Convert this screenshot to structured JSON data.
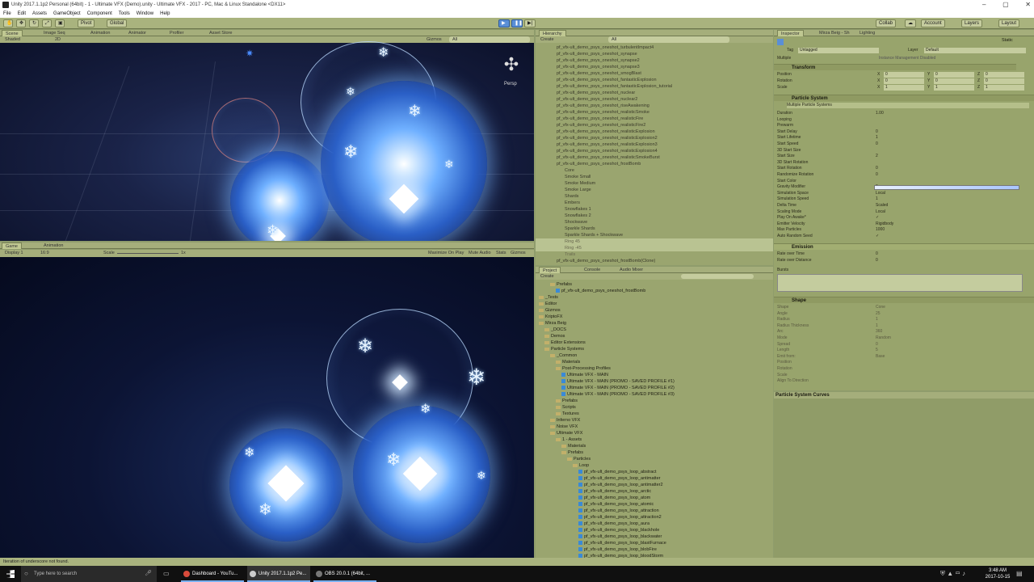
{
  "window": {
    "title": "Unity 2017.1.1p2 Personal (64bit) - 1 - Ultimate VFX (Demo).unity - Ultimate VFX - 2017 - PC, Mac & Linux Standalone <DX11>"
  },
  "menu": [
    "File",
    "Edit",
    "Assets",
    "GameObject",
    "Component",
    "Tools",
    "Window",
    "Help"
  ],
  "toolbar": {
    "pivot": "Pivot",
    "global": "Global",
    "collab": "Collab",
    "account": "Account",
    "layers": "Layers",
    "layout": "Layout"
  },
  "scene_tabs": [
    "Scene",
    "Image Seq",
    "Animation",
    "Animator",
    "Profiler",
    "Asset Store"
  ],
  "scene_bar": {
    "shaded": "Shaded",
    "mode2d": "2D",
    "gizmos": "Gizmos",
    "search": "All",
    "persp": "Persp"
  },
  "game_tabs": [
    "Game",
    "Animation"
  ],
  "game_bar": {
    "display": "Display 1",
    "aspect": "16:9",
    "scale_label": "Scale",
    "scale_value": "1x",
    "maximize": "Maximize On Play",
    "mute": "Mute Audio",
    "stats": "Stats",
    "gizmos": "Gizmos"
  },
  "hierarchy": {
    "tab": "Hierarchy",
    "create": "Create",
    "search": "All",
    "items": [
      "pf_vfx-ult_demo_psys_oneshot_turbulentImpact4",
      "pf_vfx-ult_demo_psys_oneshot_synapse",
      "pf_vfx-ult_demo_psys_oneshot_synapse2",
      "pf_vfx-ult_demo_psys_oneshot_synapse3",
      "pf_vfx-ult_demo_psys_oneshot_smogBlast",
      "pf_vfx-ult_demo_psys_oneshot_fantasticExplosion",
      "pf_vfx-ult_demo_psys_oneshot_fantasticExplosion_tutorial",
      "pf_vfx-ult_demo_psys_oneshot_nuclear",
      "pf_vfx-ult_demo_psys_oneshot_nuclear2",
      "pf_vfx-ult_demo_psys_oneshot_riseAwakening",
      "pf_vfx-ult_demo_psys_oneshot_realisticSmoke",
      "pf_vfx-ult_demo_psys_oneshot_realisticFire",
      "pf_vfx-ult_demo_psys_oneshot_realisticFire2",
      "pf_vfx-ult_demo_psys_oneshot_realisticExplosion",
      "pf_vfx-ult_demo_psys_oneshot_realisticExplosion2",
      "pf_vfx-ult_demo_psys_oneshot_realisticExplosion3",
      "pf_vfx-ult_demo_psys_oneshot_realisticExplosion4",
      "pf_vfx-ult_demo_psys_oneshot_realisticSmokeBurst",
      "pf_vfx-ult_demo_psys_oneshot_frostBomb"
    ],
    "children": [
      "Core",
      "Smoke Small",
      "Smoke Medium",
      "Smoke Large",
      "Shards",
      "Embers",
      "Snowflakes 1",
      "Snowflakes 2",
      "Shockwave",
      "Sparkle Shards",
      "Sparkle Shards + Shockwave",
      "Ring 45",
      "Ring -45",
      "Trails"
    ],
    "last": "pf_vfx-ult_demo_psys_oneshot_frostBomb(Clone)"
  },
  "project": {
    "tabs": [
      "Project",
      "Console",
      "Audio Mixer"
    ],
    "create": "Create",
    "rows": [
      {
        "d": 2,
        "t": "Prefabs",
        "k": "f"
      },
      {
        "d": 3,
        "t": "pf_vfx-ult_demo_psys_oneshot_frostBomb",
        "k": "c"
      },
      {
        "d": 0,
        "t": "_Tests",
        "k": "f"
      },
      {
        "d": 0,
        "t": "Editor",
        "k": "f"
      },
      {
        "d": 0,
        "t": "Gizmos",
        "k": "f"
      },
      {
        "d": 0,
        "t": "KriptoFX",
        "k": "f"
      },
      {
        "d": 0,
        "t": "Mirza Beig",
        "k": "f"
      },
      {
        "d": 1,
        "t": "_DOCS",
        "k": "f"
      },
      {
        "d": 1,
        "t": "Demos",
        "k": "f"
      },
      {
        "d": 1,
        "t": "Editor Extensions",
        "k": "f"
      },
      {
        "d": 1,
        "t": "Particle Systems",
        "k": "f"
      },
      {
        "d": 2,
        "t": "_Common",
        "k": "f"
      },
      {
        "d": 3,
        "t": "Materials",
        "k": "f"
      },
      {
        "d": 3,
        "t": "Post-Processing Profiles",
        "k": "f"
      },
      {
        "d": 4,
        "t": "Ultimate VFX - MAIN",
        "k": "c"
      },
      {
        "d": 4,
        "t": "Ultimate VFX - MAIN (PROMO - SAVED PROFILE #1)",
        "k": "c"
      },
      {
        "d": 4,
        "t": "Ultimate VFX - MAIN (PROMO - SAVED PROFILE #2)",
        "k": "c"
      },
      {
        "d": 4,
        "t": "Ultimate VFX - MAIN (PROMO - SAVED PROFILE #3)",
        "k": "c"
      },
      {
        "d": 3,
        "t": "Prefabs",
        "k": "f"
      },
      {
        "d": 3,
        "t": "Scripts",
        "k": "f"
      },
      {
        "d": 3,
        "t": "Textures",
        "k": "f"
      },
      {
        "d": 2,
        "t": "Inferno VFX",
        "k": "f"
      },
      {
        "d": 2,
        "t": "Noise VFX",
        "k": "f"
      },
      {
        "d": 2,
        "t": "Ultimate VFX",
        "k": "f"
      },
      {
        "d": 3,
        "t": "1 - Assets",
        "k": "f"
      },
      {
        "d": 4,
        "t": "Materials",
        "k": "f"
      },
      {
        "d": 4,
        "t": "Prefabs",
        "k": "f"
      },
      {
        "d": 5,
        "t": "Particles",
        "k": "f"
      },
      {
        "d": 6,
        "t": "Loop",
        "k": "f"
      },
      {
        "d": 7,
        "t": "pf_vfx-ult_demo_psys_loop_abstract",
        "k": "c"
      },
      {
        "d": 7,
        "t": "pf_vfx-ult_demo_psys_loop_antimatter",
        "k": "c"
      },
      {
        "d": 7,
        "t": "pf_vfx-ult_demo_psys_loop_antimatter2",
        "k": "c"
      },
      {
        "d": 7,
        "t": "pf_vfx-ult_demo_psys_loop_arctic",
        "k": "c"
      },
      {
        "d": 7,
        "t": "pf_vfx-ult_demo_psys_loop_atom",
        "k": "c"
      },
      {
        "d": 7,
        "t": "pf_vfx-ult_demo_psys_loop_atomic",
        "k": "c"
      },
      {
        "d": 7,
        "t": "pf_vfx-ult_demo_psys_loop_attraction",
        "k": "c"
      },
      {
        "d": 7,
        "t": "pf_vfx-ult_demo_psys_loop_attraction2",
        "k": "c"
      },
      {
        "d": 7,
        "t": "pf_vfx-ult_demo_psys_loop_aura",
        "k": "c"
      },
      {
        "d": 7,
        "t": "pf_vfx-ult_demo_psys_loop_blackhole",
        "k": "c"
      },
      {
        "d": 7,
        "t": "pf_vfx-ult_demo_psys_loop_blackwater",
        "k": "c"
      },
      {
        "d": 7,
        "t": "pf_vfx-ult_demo_psys_loop_blastFurnace",
        "k": "c"
      },
      {
        "d": 7,
        "t": "pf_vfx-ult_demo_psys_loop_blobFire",
        "k": "c"
      },
      {
        "d": 7,
        "t": "pf_vfx-ult_demo_psys_loop_bloodStorm",
        "k": "c"
      }
    ]
  },
  "inspector": {
    "tabs": [
      "Inspector",
      "Mirza Beig - Sh",
      "Lighting"
    ],
    "static": "Static",
    "tag_label": "Tag",
    "tag": "Untagged",
    "layer_label": "Layer",
    "layer": "Default",
    "multiple": "Multiple",
    "instance_note": "Instance Management Disabled",
    "transform": "Transform",
    "pos": "Position",
    "rot": "Rotation",
    "scale": "Scale",
    "pos_v": [
      "0",
      "0",
      "0"
    ],
    "rot_v": [
      "0",
      "0",
      "0"
    ],
    "scale_v": [
      "1",
      "1",
      "1"
    ],
    "ps_title": "Particle System",
    "ps_sub": "Multiple Particle Systems",
    "props": [
      [
        "Duration",
        "1.00"
      ],
      [
        "Looping",
        ""
      ],
      [
        "Prewarm",
        ""
      ],
      [
        "Start Delay",
        "0"
      ],
      [
        "Start Lifetime",
        "1"
      ],
      [
        "Start Speed",
        "0"
      ],
      [
        "3D Start Size",
        ""
      ],
      [
        "Start Size",
        "2"
      ],
      [
        "3D Start Rotation",
        ""
      ],
      [
        "Start Rotation",
        "0"
      ],
      [
        "Randomize Rotation",
        "0"
      ],
      [
        "Start Color",
        ""
      ],
      [
        "Gravity Modifier",
        "0"
      ],
      [
        "Simulation Space",
        "Local"
      ],
      [
        "Simulation Speed",
        "1"
      ],
      [
        "Delta Time",
        "Scaled"
      ],
      [
        "Scaling Mode",
        "Local"
      ],
      [
        "Play On Awake*",
        "✓"
      ],
      [
        "Emitter Velocity",
        "Rigidbody"
      ],
      [
        "Max Particles",
        "1000"
      ],
      [
        "Auto Random Seed",
        "✓"
      ]
    ],
    "emission": "Emission",
    "em_props": [
      [
        "Rate over Time",
        "0"
      ],
      [
        "Rate over Distance",
        "0"
      ]
    ],
    "bursts": "Bursts",
    "shape": "Shape",
    "shape_props": [
      [
        "Shape",
        "Cone"
      ],
      [
        "Angle",
        "25"
      ],
      [
        "Radius",
        "1"
      ],
      [
        "Radius Thickness",
        "1"
      ],
      [
        "Arc",
        "360"
      ],
      [
        "Mode",
        "Random"
      ],
      [
        "Spread",
        "0"
      ],
      [
        "Length",
        "5"
      ],
      [
        "Emit from:",
        "Base"
      ],
      [
        "Position",
        ""
      ],
      [
        "Rotation",
        ""
      ],
      [
        "Scale",
        ""
      ],
      [
        "Align To Direction",
        ""
      ]
    ]
  },
  "curves": {
    "title": "Particle System Curves"
  },
  "status": {
    "text": "Iteration of underscore not found."
  },
  "taskbar": {
    "search": "Type here to search",
    "apps": [
      "Dashboard - YouTu...",
      "Unity 2017.1.1p2 Pe...",
      "OBS 20.0.1 (64bit, ..."
    ],
    "time": "3:48 AM",
    "date": "2017-10-15"
  },
  "colors": {
    "accent": "#5a8fd6",
    "orb": "#6fb0ff"
  }
}
